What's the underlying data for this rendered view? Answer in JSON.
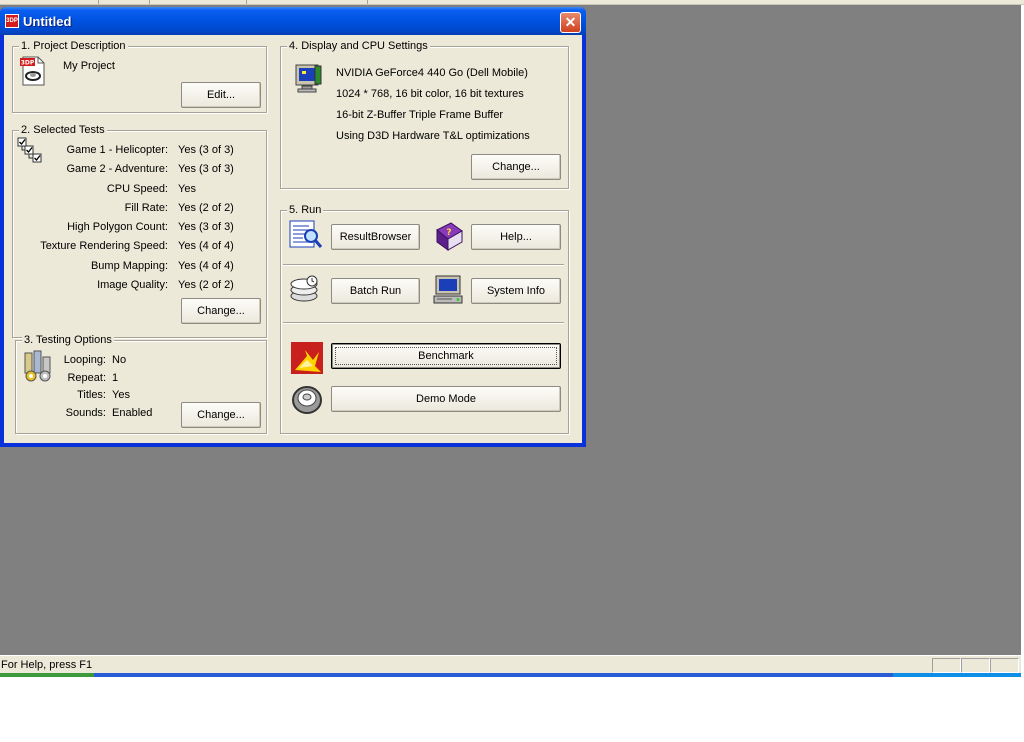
{
  "window": {
    "title": "Untitled",
    "icon_text": "3DP",
    "close_glyph": "✕"
  },
  "project": {
    "legend": "1. Project Description",
    "name": "My Project",
    "edit_button": "Edit..."
  },
  "tests": {
    "legend": "2. Selected Tests",
    "items": [
      {
        "label": "Game 1 - Helicopter:",
        "value": "Yes (3 of 3)"
      },
      {
        "label": "Game 2 - Adventure:",
        "value": "Yes (3 of 3)"
      },
      {
        "label": "CPU Speed:",
        "value": "Yes"
      },
      {
        "label": "Fill Rate:",
        "value": "Yes (2 of 2)"
      },
      {
        "label": "High Polygon Count:",
        "value": "Yes (3 of 3)"
      },
      {
        "label": "Texture Rendering Speed:",
        "value": "Yes (4 of 4)"
      },
      {
        "label": "Bump Mapping:",
        "value": "Yes (4 of 4)"
      },
      {
        "label": "Image Quality:",
        "value": "Yes (2 of 2)"
      }
    ],
    "change_button": "Change..."
  },
  "options": {
    "legend": "3. Testing Options",
    "items": [
      {
        "label": "Looping:",
        "value": "No"
      },
      {
        "label": "Repeat:",
        "value": "1"
      },
      {
        "label": "Titles:",
        "value": "Yes"
      },
      {
        "label": "Sounds:",
        "value": "Enabled"
      }
    ],
    "change_button": "Change..."
  },
  "display": {
    "legend": "4. Display and CPU Settings",
    "lines": [
      "NVIDIA GeForce4 440 Go (Dell Mobile)",
      "1024 * 768, 16 bit color, 16 bit textures",
      "16-bit Z-Buffer  Triple Frame Buffer",
      "Using  D3D Hardware T&L optimizations"
    ],
    "change_button": "Change..."
  },
  "run": {
    "legend": "5. Run",
    "result_browser": "ResultBrowser",
    "help": "Help...",
    "batch_run": "Batch Run",
    "system_info": "System Info",
    "benchmark": "Benchmark",
    "demo_mode": "Demo Mode"
  },
  "statusbar": {
    "text": "For Help, press F1"
  },
  "icons": [
    "project-file-icon",
    "checklist-icon",
    "testing-options-icon",
    "monitor-settings-icon",
    "result-browser-icon",
    "help-book-icon",
    "batch-run-icon",
    "system-info-icon",
    "benchmark-icon",
    "demo-mode-icon"
  ],
  "colors": {
    "title_blue": "#0052e0",
    "dialog_face": "#ece9d8",
    "desktop_gray": "#808080",
    "close_red": "#d0401e"
  }
}
